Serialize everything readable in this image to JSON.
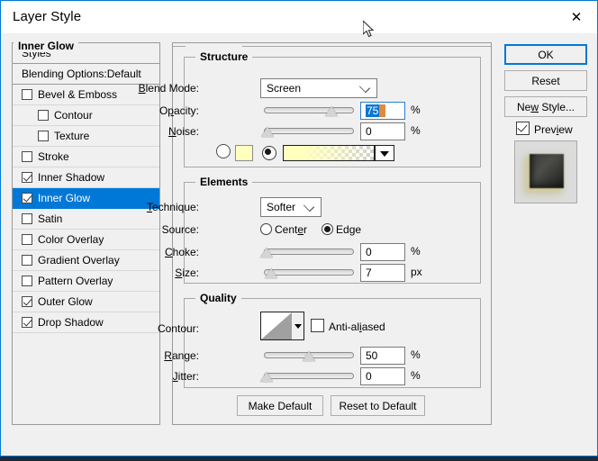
{
  "window": {
    "title": "Layer Style",
    "close_icon": "close-icon"
  },
  "sidebar": {
    "header": "Styles",
    "blending_options": "Blending Options:Default",
    "effects": [
      {
        "label": "Bevel & Emboss",
        "checked": false,
        "indent": false,
        "selected": false
      },
      {
        "label": "Contour",
        "checked": false,
        "indent": true,
        "selected": false
      },
      {
        "label": "Texture",
        "checked": false,
        "indent": true,
        "selected": false
      },
      {
        "label": "Stroke",
        "checked": false,
        "indent": false,
        "selected": false
      },
      {
        "label": "Inner Shadow",
        "checked": true,
        "indent": false,
        "selected": false
      },
      {
        "label": "Inner Glow",
        "checked": true,
        "indent": false,
        "selected": true
      },
      {
        "label": "Satin",
        "checked": false,
        "indent": false,
        "selected": false
      },
      {
        "label": "Color Overlay",
        "checked": false,
        "indent": false,
        "selected": false
      },
      {
        "label": "Gradient Overlay",
        "checked": false,
        "indent": false,
        "selected": false
      },
      {
        "label": "Pattern Overlay",
        "checked": false,
        "indent": false,
        "selected": false
      },
      {
        "label": "Outer Glow",
        "checked": true,
        "indent": false,
        "selected": false
      },
      {
        "label": "Drop Shadow",
        "checked": true,
        "indent": false,
        "selected": false
      }
    ]
  },
  "main": {
    "panel_title": "Inner Glow",
    "structure": {
      "title": "Structure",
      "blend_mode_label": "Blend Mode:",
      "blend_mode_value": "Screen",
      "opacity_label": "Opacity:",
      "opacity_value": "75",
      "opacity_unit": "%",
      "noise_label": "Noise:",
      "noise_value": "0",
      "noise_unit": "%",
      "color_fill_selected": false,
      "gradient_fill_selected": true,
      "color_swatch_hex": "#FFFFBE",
      "gradient_name": "foreground-to-transparent"
    },
    "elements": {
      "title": "Elements",
      "technique_label": "Technique:",
      "technique_value": "Softer",
      "source_label": "Source:",
      "source_center_label": "Center",
      "source_edge_label": "Edge",
      "source_selected": "Edge",
      "choke_label": "Choke:",
      "choke_value": "0",
      "choke_unit": "%",
      "size_label": "Size:",
      "size_value": "7",
      "size_unit": "px"
    },
    "quality": {
      "title": "Quality",
      "contour_label": "Contour:",
      "contour_preset": "linear-ramp",
      "antialiased_label": "Anti-aliased",
      "antialiased_checked": false,
      "range_label": "Range:",
      "range_value": "50",
      "range_unit": "%",
      "jitter_label": "Jitter:",
      "jitter_value": "0",
      "jitter_unit": "%"
    },
    "make_default_label": "Make Default",
    "reset_to_default_label": "Reset to Default"
  },
  "rail": {
    "ok_label": "OK",
    "reset_label": "Reset",
    "new_style_label": "New Style...",
    "preview_label": "Preview",
    "preview_checked": true
  },
  "colors": {
    "accent": "#0078D7",
    "dialog_bg": "#F0F0F0",
    "selection_blue": "#0A76D3",
    "caret_orange": "#E08A3C",
    "glow_yellow": "#FFFFBE"
  }
}
